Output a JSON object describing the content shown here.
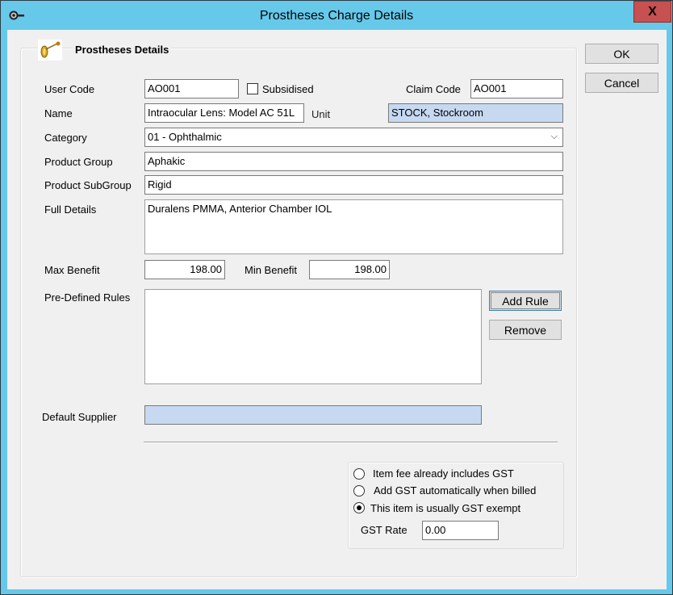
{
  "window": {
    "title": "Prostheses Charge Details",
    "title_icon": "key-icon",
    "close_label": "X"
  },
  "group": {
    "title": "Prostheses Details",
    "icon": "prosthesis-key-icon"
  },
  "form": {
    "user_code": {
      "label": "User Code",
      "value": "AO001"
    },
    "subsidised": {
      "label": "Subsidised",
      "checked": false
    },
    "claim_code": {
      "label": "Claim Code",
      "value": "AO001"
    },
    "name": {
      "label": "Name",
      "value": "Intraocular Lens: Model  AC 51L"
    },
    "unit": {
      "label": "Unit",
      "value": "STOCK, Stockroom"
    },
    "category": {
      "label": "Category",
      "value": "01 - Ophthalmic"
    },
    "product_group": {
      "label": "Product Group",
      "value": "Aphakic"
    },
    "product_subgroup": {
      "label": "Product SubGroup",
      "value": "Rigid"
    },
    "full_details": {
      "label": "Full Details",
      "value": "Duralens  PMMA, Anterior Chamber IOL"
    },
    "max_benefit": {
      "label": "Max Benefit",
      "value": "198.00"
    },
    "min_benefit": {
      "label": "Min Benefit",
      "value": "198.00"
    },
    "rules": {
      "label": "Pre-Defined Rules",
      "items": []
    },
    "default_supplier": {
      "label": "Default Supplier",
      "value": ""
    }
  },
  "buttons": {
    "ok": "OK",
    "cancel": "Cancel",
    "add_rule": "Add Rule",
    "remove": "Remove"
  },
  "gst": {
    "options": [
      {
        "label": "Item fee already includes GST",
        "selected": false
      },
      {
        "label": "Add GST automatically when billed",
        "selected": false
      },
      {
        "label": "This item is usually GST exempt",
        "selected": true
      }
    ],
    "rate_label": "GST Rate",
    "rate_value": "0.00"
  }
}
